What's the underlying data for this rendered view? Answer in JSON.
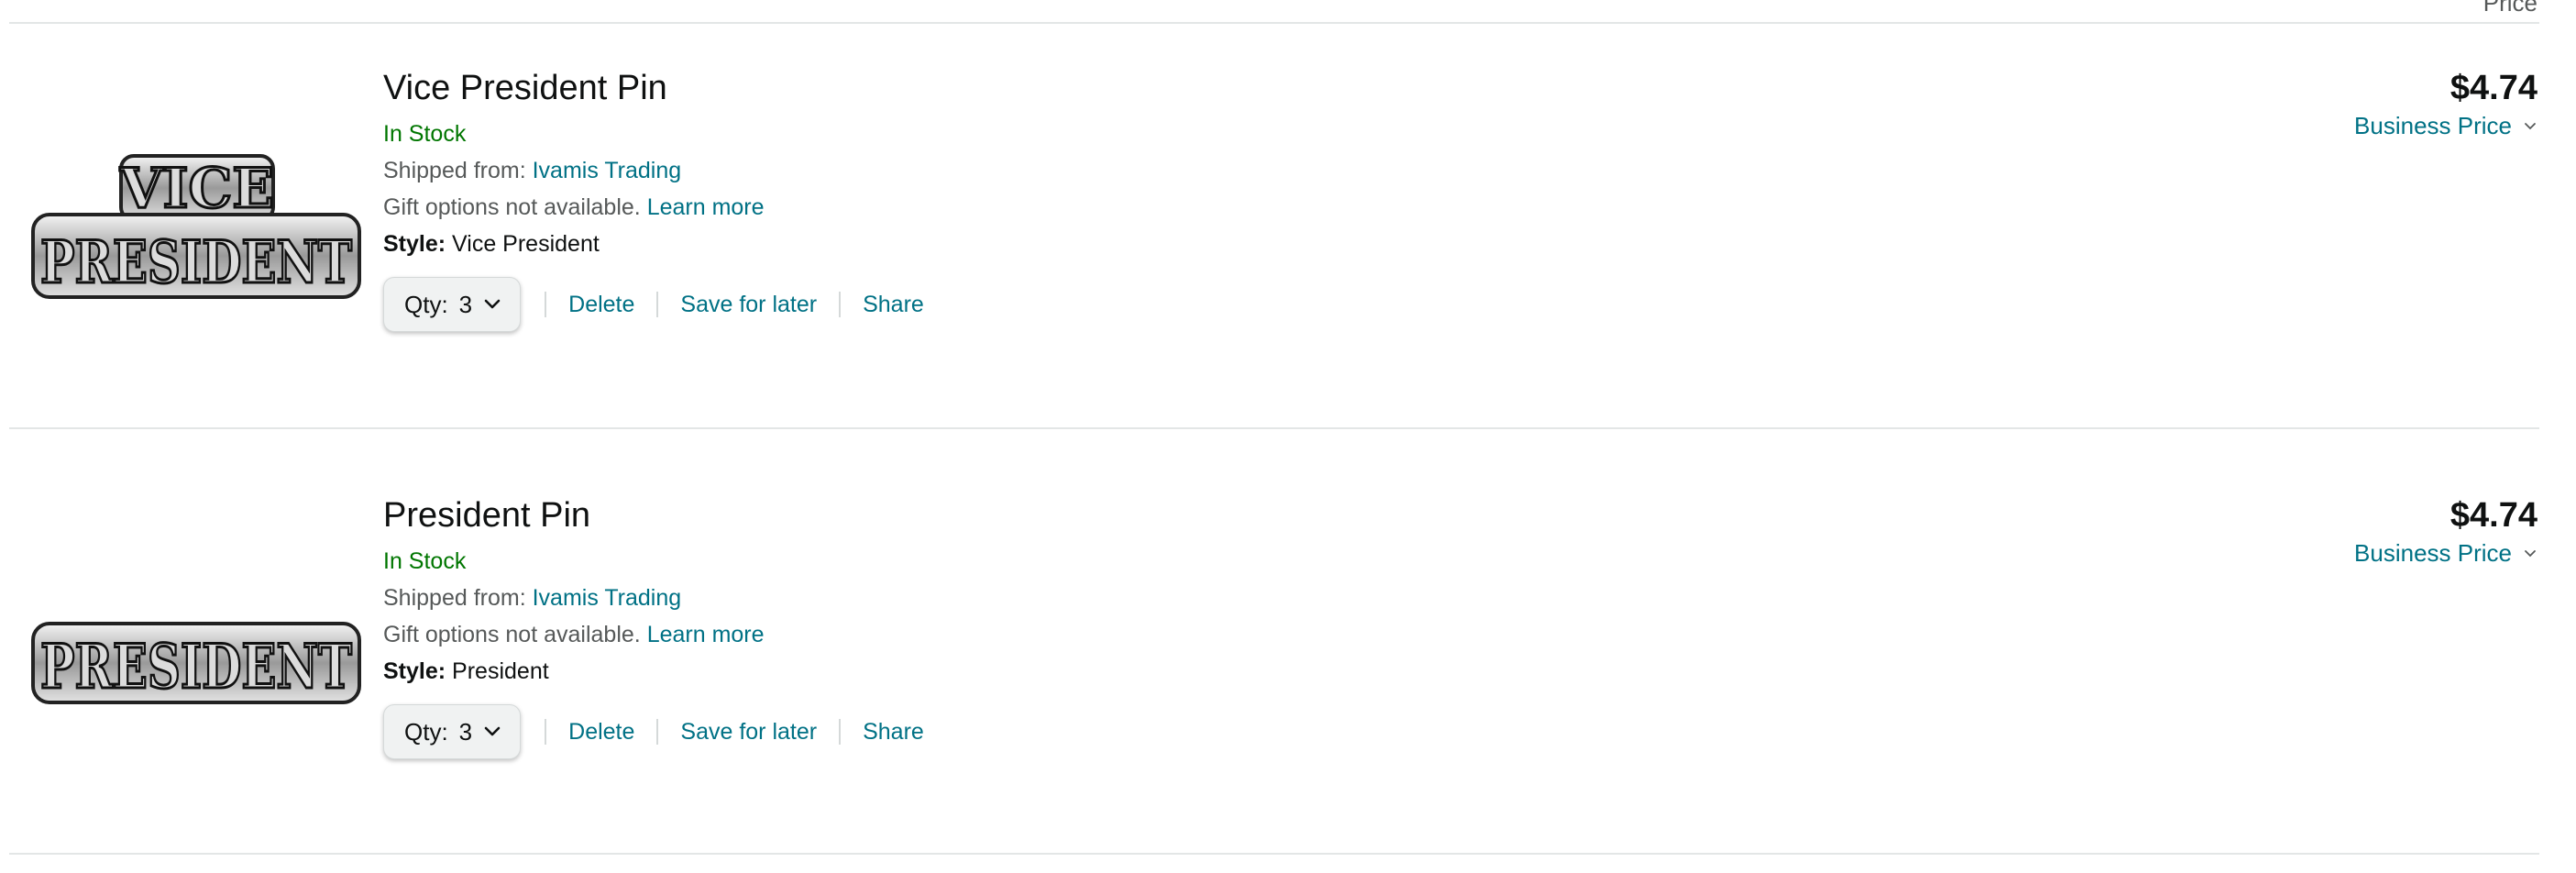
{
  "header": {
    "price_column_label": "Price"
  },
  "items": [
    {
      "title": "Vice President Pin",
      "stock": "In Stock",
      "shipped_label": "Shipped from:",
      "seller": "Ivamis Trading",
      "gift_text": "Gift options not available.",
      "learn_more": "Learn more",
      "style_label": "Style:",
      "style_value": "Vice President",
      "qty_label": "Qty:",
      "qty_value": "3",
      "delete_label": "Delete",
      "save_label": "Save for later",
      "share_label": "Share",
      "price": "$4.74",
      "business_price_label": "Business Price",
      "image_text": [
        "VICE",
        "PRESIDENT"
      ]
    },
    {
      "title": "President Pin",
      "stock": "In Stock",
      "shipped_label": "Shipped from:",
      "seller": "Ivamis Trading",
      "gift_text": "Gift options not available.",
      "learn_more": "Learn more",
      "style_label": "Style:",
      "style_value": "President",
      "qty_label": "Qty:",
      "qty_value": "3",
      "delete_label": "Delete",
      "save_label": "Save for later",
      "share_label": "Share",
      "price": "$4.74",
      "business_price_label": "Business Price",
      "image_text": [
        "PRESIDENT"
      ]
    }
  ],
  "colors": {
    "link": "#007185",
    "in_stock": "#007600",
    "text": "#0F1111",
    "secondary_text": "#565959"
  }
}
